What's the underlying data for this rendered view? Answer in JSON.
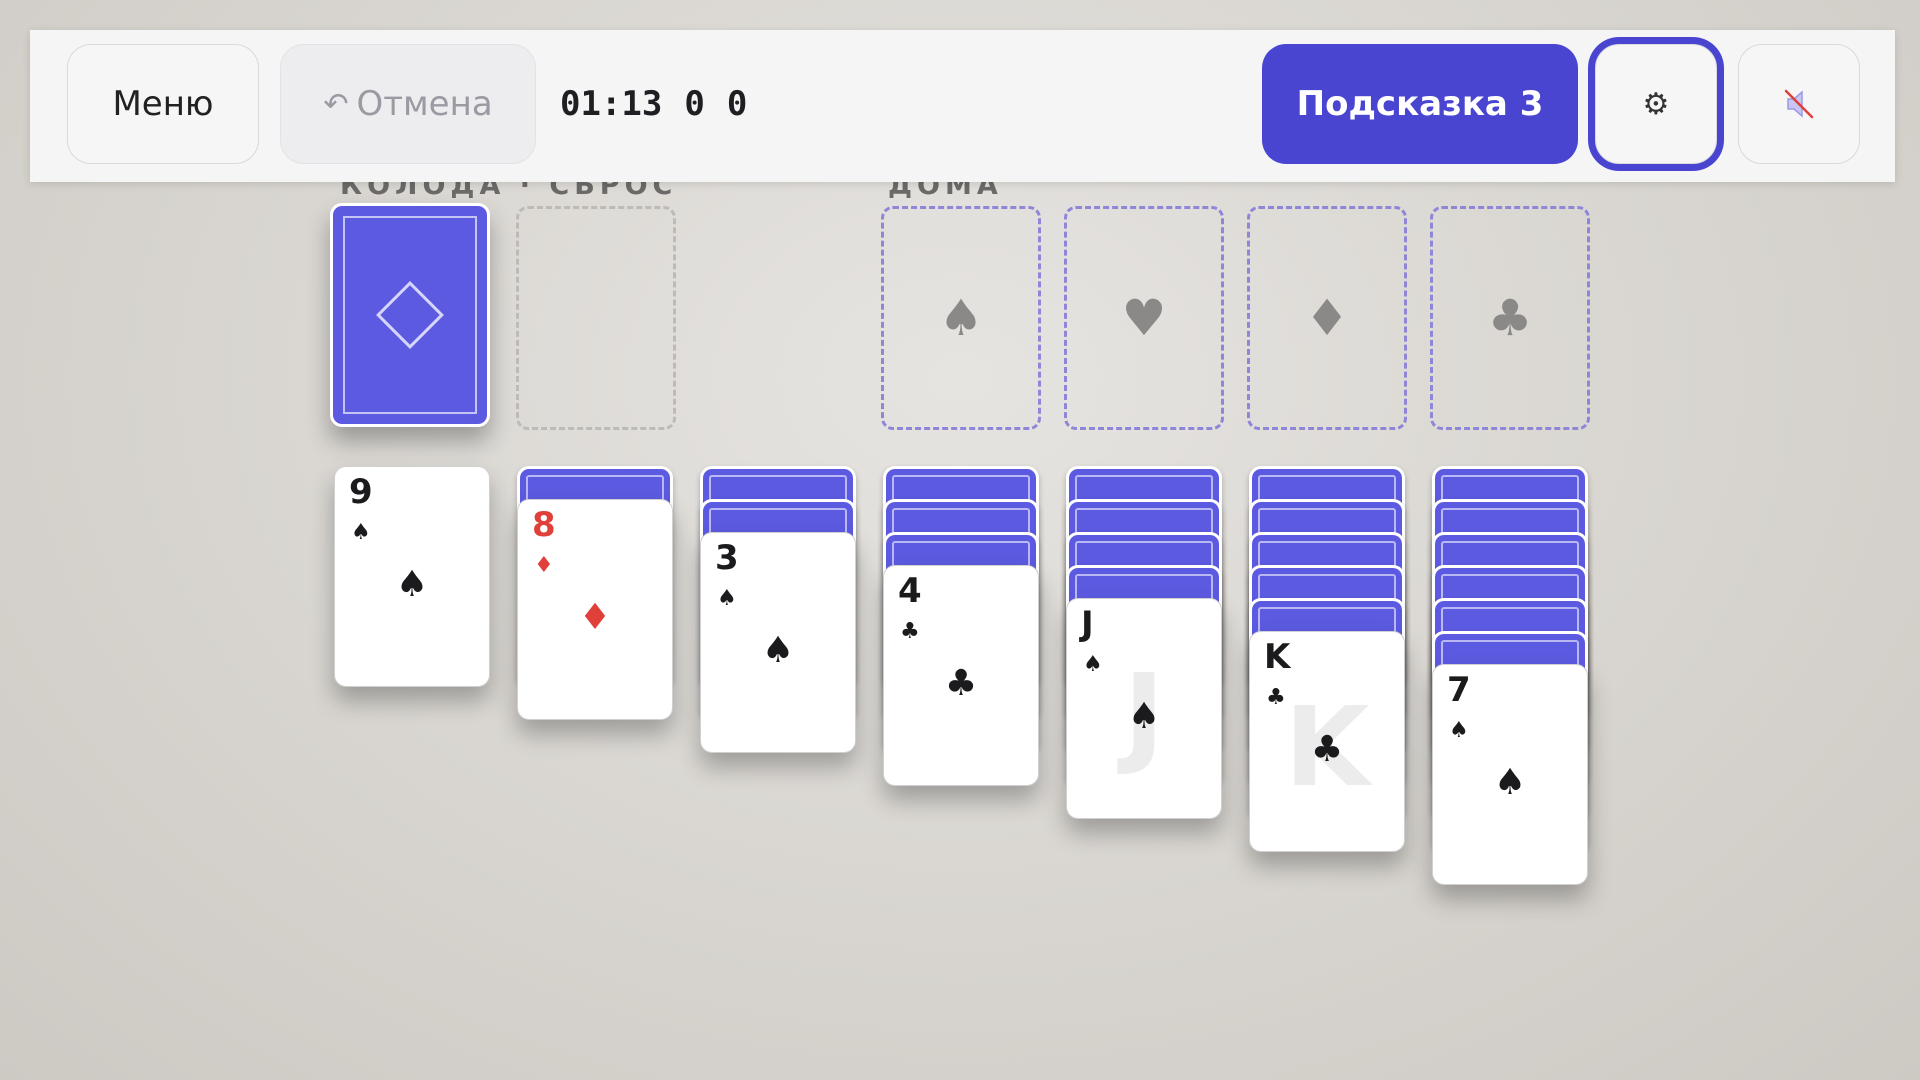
{
  "topbar": {
    "menu_label": "Меню",
    "undo_icon": "↶",
    "undo_label": "Отмена",
    "timer": "01:13",
    "moves": "0",
    "score": "0",
    "hint_label": "Подсказка 3",
    "settings_icon": "⚙",
    "sound_icon": "speaker-muted-icon"
  },
  "labels": {
    "stock_waste": "КОЛОДА · СБРОС",
    "foundations": "ДОМА"
  },
  "foundations": [
    "♠",
    "♥",
    "♦",
    "♣"
  ],
  "tableau": [
    {
      "rank": "9",
      "suit": "♠",
      "color": "black"
    },
    {
      "rank": "8",
      "suit": "♦",
      "color": "red"
    },
    {
      "rank": "3",
      "suit": "♠",
      "color": "black"
    },
    {
      "rank": "4",
      "suit": "♣",
      "color": "black"
    },
    {
      "rank": "J",
      "suit": "♠",
      "color": "black"
    },
    {
      "rank": "K",
      "suit": "♣",
      "color": "black"
    },
    {
      "rank": "7",
      "suit": "♠",
      "color": "black"
    }
  ],
  "colors": {
    "accent": "#4a45d1",
    "card_back": "#5c5ae0",
    "red_suit": "#e0403a"
  }
}
